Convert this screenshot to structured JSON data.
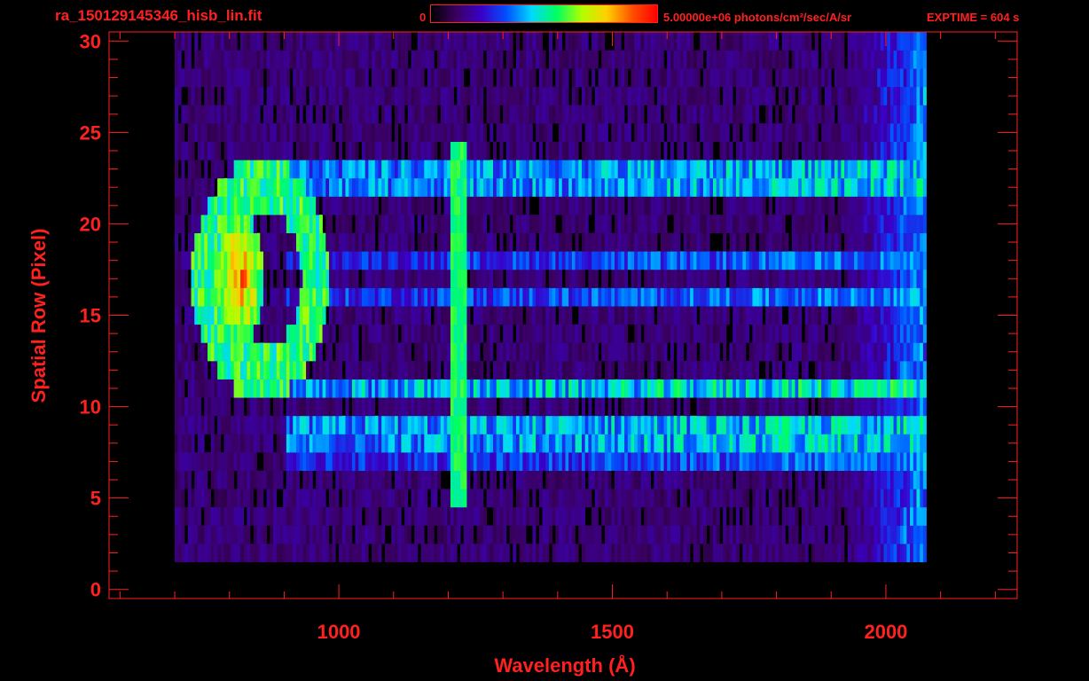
{
  "header": {
    "filename": "ra_150129145346_hisb_lin.fit",
    "colorbar_min": "0",
    "colorbar_max_value": "5.00000e+06",
    "colorbar_units": "photons/cm²/sec/A/sr",
    "exptime": "EXPTIME = 604 s"
  },
  "colors": {
    "axis": "#ff2020",
    "background": "#000000",
    "colormap": [
      "#000000",
      "#3a0060",
      "#3a00c8",
      "#0050ff",
      "#00d8ff",
      "#00ff60",
      "#b0ff00",
      "#ffd000",
      "#ff5000",
      "#ff0000"
    ]
  },
  "chart_data": {
    "type": "heatmap",
    "title": "ra_150129145346_hisb_lin.fit",
    "xlabel": "Wavelength (Å)",
    "ylabel": "Spatial Row (Pixel)",
    "xlim": [
      580,
      2240
    ],
    "ylim": [
      -0.5,
      30.5
    ],
    "x_ticks": [
      "1000",
      "1500",
      "2000"
    ],
    "x_tick_values": [
      1000,
      1500,
      2000
    ],
    "y_ticks": [
      "0",
      "5",
      "10",
      "15",
      "20",
      "25",
      "30"
    ],
    "y_tick_values": [
      0,
      5,
      10,
      15,
      20,
      25,
      30
    ],
    "colorbar_range": [
      0,
      5000000
    ],
    "colorbar_units": "photons/cm²/sec/A/sr",
    "data_extent": {
      "wavelength_min": 700,
      "wavelength_max": 2070,
      "rows_min": 2,
      "rows_max": 30
    },
    "features": [
      {
        "kind": "ring",
        "wavelength_center": 855,
        "row_center": 17,
        "wavelength_halfwidth": 115,
        "row_halfwidth": 6,
        "level": 0.55
      },
      {
        "kind": "bright_core",
        "wavelength_center": 815,
        "row_center": 17,
        "wavelength_halfwidth": 45,
        "row_halfwidth": 3.5,
        "level": 0.9
      },
      {
        "kind": "vertical_line",
        "wavelength": 1216,
        "row_min": 5,
        "row_max": 24,
        "level": 0.55
      },
      {
        "kind": "horizontal_band",
        "row": 22.5,
        "wavelength_min": 900,
        "wavelength_max": 2070,
        "level": 0.4
      },
      {
        "kind": "horizontal_band",
        "row": 18,
        "wavelength_min": 900,
        "wavelength_max": 2070,
        "level": 0.3
      },
      {
        "kind": "horizontal_band",
        "row": 16,
        "wavelength_min": 900,
        "wavelength_max": 2070,
        "level": 0.32
      },
      {
        "kind": "horizontal_band",
        "row": 11,
        "wavelength_min": 900,
        "wavelength_max": 2070,
        "level": 0.45
      },
      {
        "kind": "horizontal_band",
        "row": 8.5,
        "wavelength_min": 900,
        "wavelength_max": 2070,
        "level": 0.42
      },
      {
        "kind": "horizontal_band",
        "row": 7,
        "wavelength_min": 900,
        "wavelength_max": 2070,
        "level": 0.3
      },
      {
        "kind": "red_edge",
        "wavelength_min": 1900,
        "wavelength_max": 2070,
        "level": 0.35
      }
    ]
  }
}
